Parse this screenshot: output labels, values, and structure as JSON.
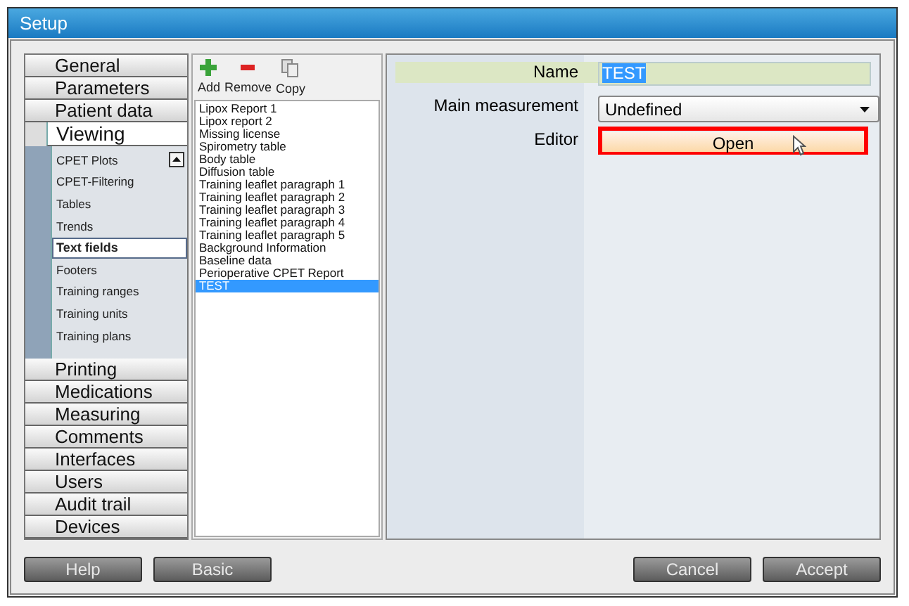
{
  "window": {
    "title": "Setup"
  },
  "nav": [
    {
      "label": "General",
      "selected": false
    },
    {
      "label": "Parameters",
      "selected": false
    },
    {
      "label": "Patient data",
      "selected": false
    },
    {
      "label": "Viewing",
      "selected": true,
      "expanded": true,
      "children": [
        {
          "label": "CPET Plots",
          "selected": false
        },
        {
          "label": "CPET-Filtering",
          "selected": false
        },
        {
          "label": "Tables",
          "selected": false
        },
        {
          "label": "Trends",
          "selected": false
        },
        {
          "label": "Text fields",
          "selected": true
        },
        {
          "label": "Footers",
          "selected": false
        },
        {
          "label": "Training ranges",
          "selected": false
        },
        {
          "label": "Training units",
          "selected": false
        },
        {
          "label": "Training plans",
          "selected": false
        }
      ]
    },
    {
      "label": "Printing",
      "selected": false
    },
    {
      "label": "Medications",
      "selected": false
    },
    {
      "label": "Measuring",
      "selected": false
    },
    {
      "label": "Comments",
      "selected": false
    },
    {
      "label": "Interfaces",
      "selected": false
    },
    {
      "label": "Users",
      "selected": false
    },
    {
      "label": "Audit trail",
      "selected": false
    },
    {
      "label": "Devices",
      "selected": false
    }
  ],
  "toolbar": [
    {
      "kind": "add",
      "label": "Add"
    },
    {
      "kind": "remove",
      "label": "Remove"
    },
    {
      "kind": "copy",
      "label": "Copy"
    }
  ],
  "list": [
    {
      "label": "Lipox Report 1",
      "selected": false
    },
    {
      "label": "Lipox report 2",
      "selected": false
    },
    {
      "label": "Missing license",
      "selected": false
    },
    {
      "label": "Spirometry table",
      "selected": false
    },
    {
      "label": "Body table",
      "selected": false
    },
    {
      "label": "Diffusion table",
      "selected": false
    },
    {
      "label": "Training leaflet paragraph 1",
      "selected": false
    },
    {
      "label": "Training leaflet paragraph 2",
      "selected": false
    },
    {
      "label": "Training leaflet paragraph 3",
      "selected": false
    },
    {
      "label": "Training leaflet paragraph 4",
      "selected": false
    },
    {
      "label": "Training leaflet paragraph 5",
      "selected": false
    },
    {
      "label": "Background Information",
      "selected": false
    },
    {
      "label": "Baseline data",
      "selected": false
    },
    {
      "label": "Perioperative CPET Report",
      "selected": false
    },
    {
      "label": "TEST",
      "selected": true
    }
  ],
  "form": [
    {
      "kind": "text",
      "label": "Name",
      "value": "TEST",
      "focused": true
    },
    {
      "kind": "dropdown",
      "label": "Main measurement",
      "value": "Undefined"
    },
    {
      "kind": "button",
      "label": "Editor",
      "value": "Open",
      "highlighted": true
    }
  ],
  "footer": {
    "left": [
      "Help",
      "Basic"
    ],
    "right": [
      "Cancel",
      "Accept"
    ]
  }
}
